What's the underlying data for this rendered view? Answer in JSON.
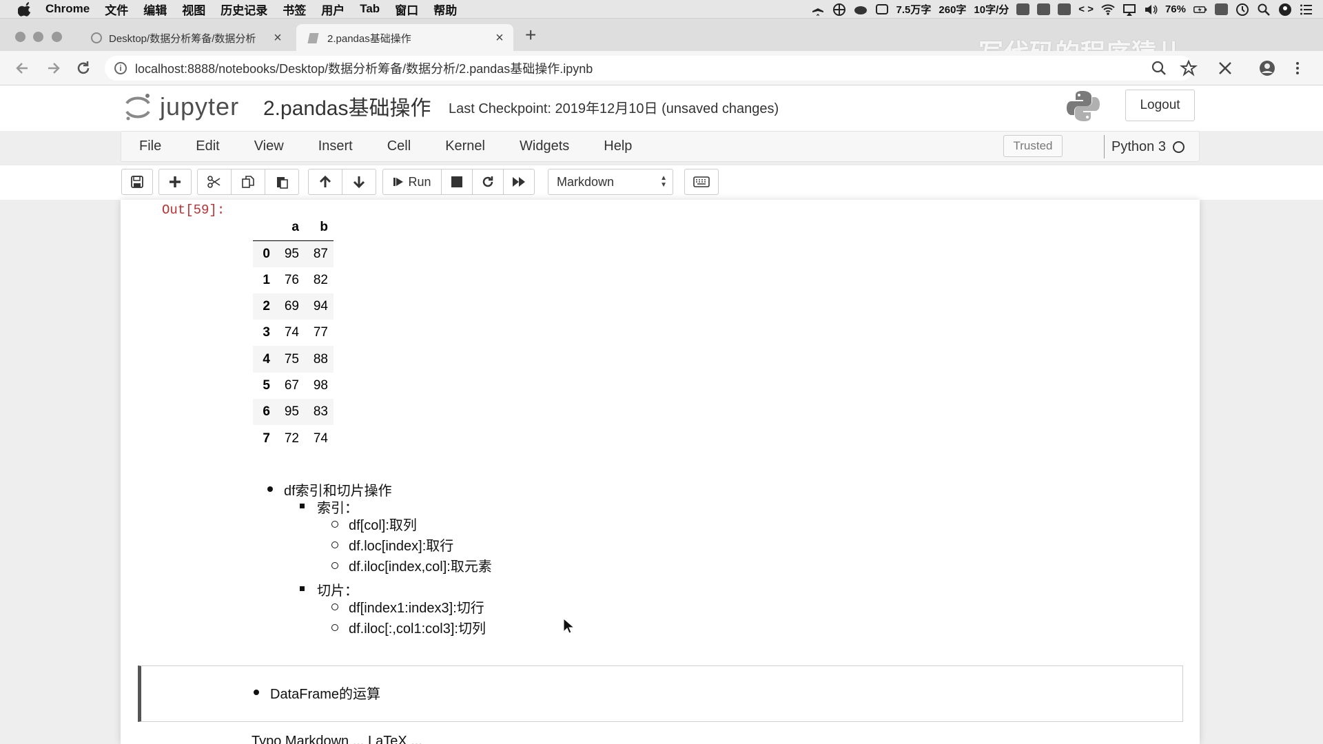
{
  "mac_menubar": {
    "app": "Chrome",
    "items": [
      "文件",
      "编辑",
      "视图",
      "历史记录",
      "书签",
      "用户",
      "Tab",
      "窗口",
      "帮助"
    ],
    "status": [
      "7.5万字",
      "260字",
      "10字/分"
    ],
    "battery": "76%"
  },
  "tabs": [
    {
      "title": "Desktop/数据分析筹备/数据分析",
      "close": "×"
    },
    {
      "title": "2.pandas基础操作",
      "close": "×"
    }
  ],
  "new_tab": "+",
  "watermark": "写代码的程序猿儿",
  "address": {
    "url": "localhost:8888/notebooks/Desktop/数据分析筹备/数据分析/2.pandas基础操作.ipynb",
    "info": "i"
  },
  "jupyter": {
    "logo_text": "jupyter",
    "notebook_name": "2.pandas基础操作",
    "checkpoint": "Last Checkpoint: 2019年12月10日   (unsaved changes)",
    "logout": "Logout",
    "menu": [
      "File",
      "Edit",
      "View",
      "Insert",
      "Cell",
      "Kernel",
      "Widgets",
      "Help"
    ],
    "trusted": "Trusted",
    "kernel": "Python 3",
    "run_label": "Run",
    "cell_type": "Markdown"
  },
  "output": {
    "prompt": "Out[59]:",
    "columns": [
      "a",
      "b"
    ],
    "rows": [
      {
        "index": "0",
        "a": "95",
        "b": "87"
      },
      {
        "index": "1",
        "a": "76",
        "b": "82"
      },
      {
        "index": "2",
        "a": "69",
        "b": "94"
      },
      {
        "index": "3",
        "a": "74",
        "b": "77"
      },
      {
        "index": "4",
        "a": "75",
        "b": "88"
      },
      {
        "index": "5",
        "a": "67",
        "b": "98"
      },
      {
        "index": "6",
        "a": "95",
        "b": "83"
      },
      {
        "index": "7",
        "a": "72",
        "b": "74"
      }
    ]
  },
  "markdown": {
    "heading": "df索引和切片操作",
    "index_label": "索引：",
    "index_items": [
      "df[col]:取列",
      "df.loc[index]:取行",
      "df.iloc[index,col]:取元素"
    ],
    "slice_label": "切片：",
    "slice_items": [
      "df[index1:index3]:切行",
      "df.iloc[:,col1:col3]:切列"
    ]
  },
  "selected_cell": {
    "text": "DataFrame的运算"
  },
  "cut_line": "Typo Markdown ... LaTeX ..."
}
